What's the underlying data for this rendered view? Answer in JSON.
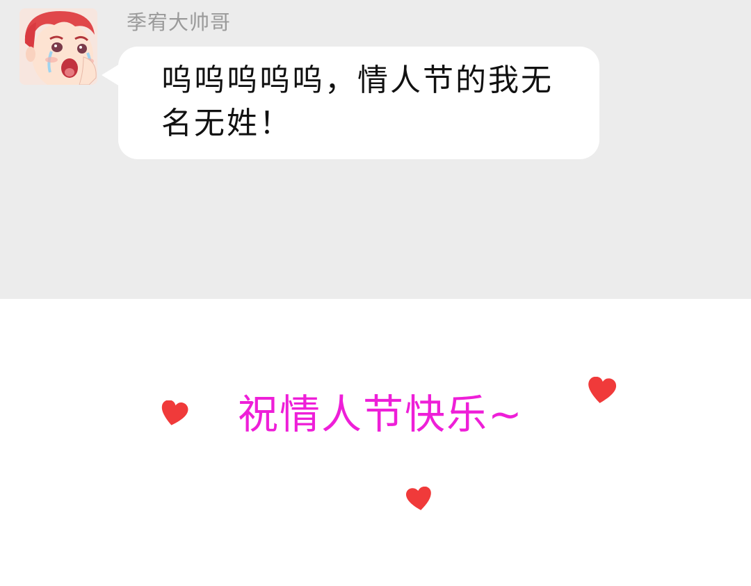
{
  "chat": {
    "sender_name": "季宥大帅哥",
    "message": "呜呜呜呜呜，情人节的我无名无姓！",
    "avatar_icon": "crying-boy-avatar-icon"
  },
  "greeting": {
    "text": "祝情人节快乐~",
    "color": "#ee1fd8"
  },
  "colors": {
    "chat_background": "#ececec",
    "bubble": "#ffffff",
    "heart": "#f03a3a",
    "sender_name": "#9a9a9a"
  },
  "decorations": {
    "heart_icon": "heart-icon"
  }
}
